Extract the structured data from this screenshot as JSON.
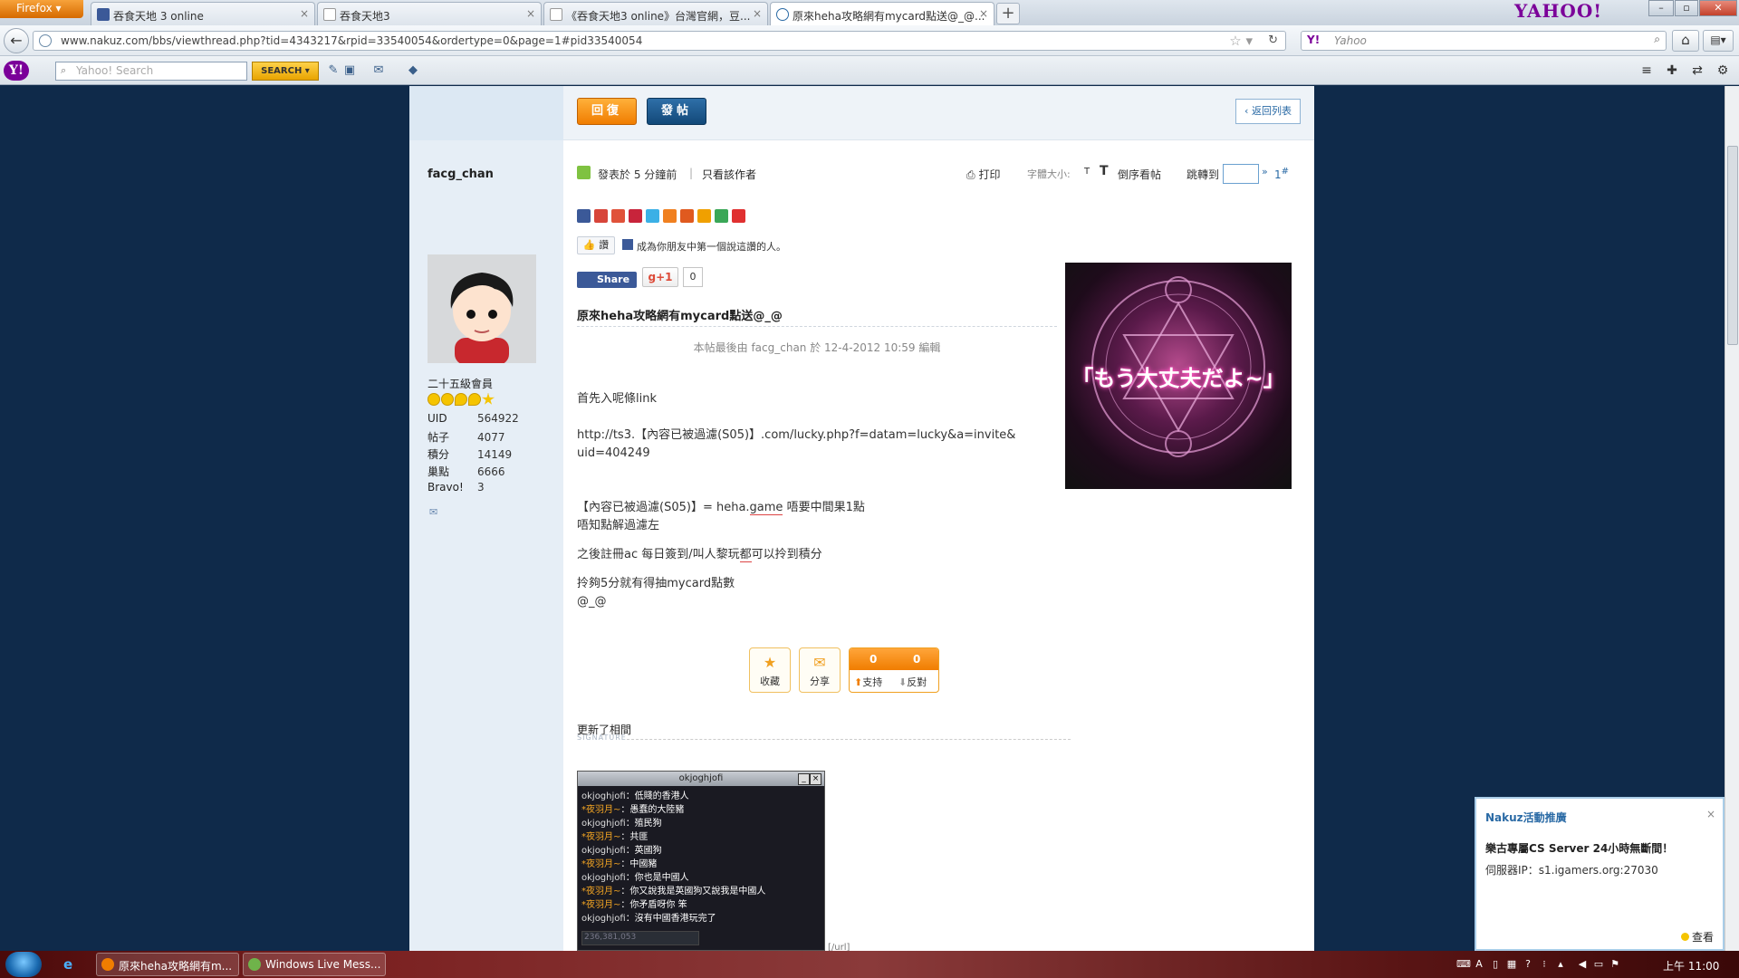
{
  "browser": {
    "menu_button": "Firefox",
    "tabs": [
      {
        "title": "吞食天地 3 online"
      },
      {
        "title": "吞食天地3"
      },
      {
        "title": "《吞食天地3 online》台灣官網，豆..."
      },
      {
        "title": "原來heha攻略網有mycard點送@_@..."
      }
    ],
    "new_tab": "+",
    "brand_logo": "YAHOO!",
    "url": "www.nakuz.com/bbs/viewthread.php?tid=4343217&rpid=33540054&ordertype=0&page=1#pid33540054",
    "search_engine": "Y!",
    "search_placeholder": "Yahoo"
  },
  "yahoo_toolbar": {
    "logo": "Y!",
    "search_placeholder": "Yahoo! Search",
    "search_button": "SEARCH"
  },
  "forum": {
    "reply_button": "回復",
    "post_button": "發帖",
    "back_to_list": "返回列表",
    "author": {
      "username": "facg_chan",
      "rank": "二十五級會員",
      "stats": [
        {
          "label": "UID",
          "value": "564922"
        },
        {
          "label": "帖子",
          "value": "4077"
        },
        {
          "label": "積分",
          "value": "14149"
        },
        {
          "label": "巢點",
          "value": "6666"
        },
        {
          "label": "Bravo!",
          "value": "3"
        }
      ]
    },
    "meta": {
      "posted": "發表於 5 分鐘前",
      "separator": "|",
      "only_author": "只看該作者",
      "print": "打印",
      "font_size_label": "字體大小:",
      "font_small": "T",
      "font_big": "T",
      "reverse": "倒序看帖",
      "jump_label": "跳轉到",
      "jump_go": "»",
      "floor": "1"
    },
    "like_button": "讚",
    "like_text": "成為你朋友中第一個說這讚的人。",
    "fb_share": "Share",
    "gplus": "+1",
    "gplus_count": "0",
    "title": "原來heha攻略網有mycard點送@_@",
    "edit_note": "本帖最後由 facg_chan 於 12-4-2012 10:59 編輯",
    "body": {
      "l1": "首先入呢條link",
      "l2": "http://ts3.【內容已被過濾(S05)】.com/lucky.php?f=datam=lucky&a=invite&",
      "l3": "uid=404249",
      "l4a": "【內容已被過濾(S05)】= heha.",
      "l4b": "game",
      "l4c": " 唔要中間果1點",
      "l5": "唔知點解過濾左",
      "l6a": "之後註冊ac 每日簽到/叫人黎玩",
      "l6b": "都",
      "l6c": "可以拎到積分",
      "l7": "拎夠5分就有得抽mycard點數",
      "l8": "@_@"
    },
    "ad_text": "「もう大丈夫だよ~」",
    "actions": {
      "favorite": "收藏",
      "share": "分享",
      "support_count": "0",
      "oppose_count": "0",
      "support": "支持",
      "oppose": "反對"
    },
    "signature": {
      "title": "更新了相間",
      "subtitle": "SIGNATURE",
      "window_title": "okjoghjofi",
      "chat": [
        {
          "name": "okjoghjofi",
          "text": "：低賤的香港人",
          "hl": false
        },
        {
          "name": "*夜羽月~",
          "text": "：愚蠢的大陸豬",
          "hl": true
        },
        {
          "name": "okjoghjofi",
          "text": "：殖民狗",
          "hl": false
        },
        {
          "name": "*夜羽月~",
          "text": "：共匪",
          "hl": true
        },
        {
          "name": "okjoghjofi",
          "text": "：英國狗",
          "hl": false
        },
        {
          "name": "*夜羽月~",
          "text": "：中國豬",
          "hl": true
        },
        {
          "name": "okjoghjofi",
          "text": "：你也是中國人",
          "hl": false
        },
        {
          "name": "*夜羽月~",
          "text": "：你又說我是英國狗又說我是中國人",
          "hl": true
        },
        {
          "name": "*夜羽月~",
          "text": "：你矛盾呀你 笨",
          "hl": true
        },
        {
          "name": "okjoghjofi",
          "text": "：沒有中國香港玩完了",
          "hl": false
        }
      ],
      "input_text": "236,381,053",
      "tail": "[/url]"
    }
  },
  "notification": {
    "title": "Nakuz活動推廣",
    "close": "×",
    "line1": "樂古專屬CS Server 24小時無斷間！",
    "line2": "伺服器IP：s1.igamers.org:27030",
    "view": "查看"
  },
  "taskbar": {
    "tasks": [
      {
        "title": "原來heha攻略網有m..."
      },
      {
        "title": "Windows Live Mess..."
      }
    ],
    "clock": "上午 11:00"
  }
}
